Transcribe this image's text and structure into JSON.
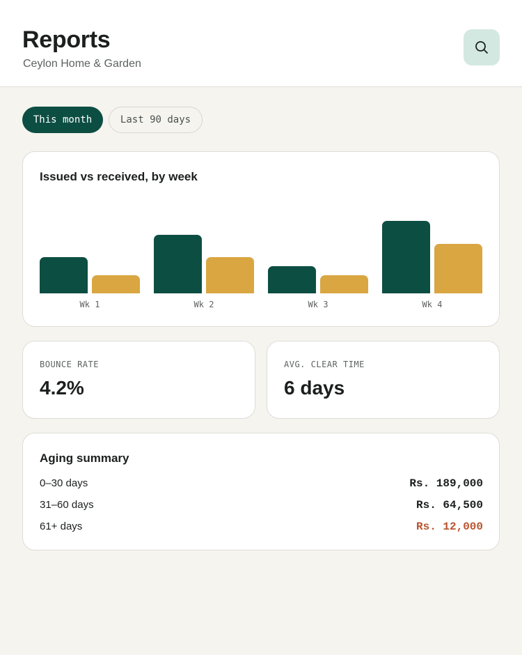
{
  "header": {
    "title": "Reports",
    "subtitle": "Ceylon Home & Garden",
    "search_icon": "search-icon"
  },
  "filters": {
    "chips": [
      {
        "label": "This month",
        "active": true
      },
      {
        "label": "Last 90 days",
        "active": false
      }
    ]
  },
  "chart_card": {
    "title": "Issued vs received, by week"
  },
  "chart_data": {
    "type": "bar",
    "title": "Issued vs received, by week",
    "categories": [
      "Wk 1",
      "Wk 2",
      "Wk 3",
      "Wk 4"
    ],
    "series": [
      {
        "values": [
          52,
          84,
          39,
          104
        ],
        "color": "#0d4e43"
      },
      {
        "values": [
          26,
          52,
          26,
          71
        ],
        "color": "#d9a642"
      }
    ],
    "ylim": [
      0,
      110
    ],
    "grid": false,
    "legend": "none"
  },
  "kpis": [
    {
      "label": "BOUNCE RATE",
      "value": "4.2%"
    },
    {
      "label": "AVG. CLEAR TIME",
      "value": "6 days"
    }
  ],
  "aging": {
    "title": "Aging summary",
    "rows": [
      {
        "label": "0–30 days",
        "amount": "Rs. 189,000"
      },
      {
        "label": "31–60 days",
        "amount": "Rs. 64,500"
      },
      {
        "label": "61+ days",
        "amount": "Rs. 12,000",
        "alert": true
      }
    ]
  },
  "colors": {
    "brand": "#0d4e43",
    "accent": "#d9a642",
    "alert": "#b8542f",
    "search_bg": "#d3e8e1"
  }
}
